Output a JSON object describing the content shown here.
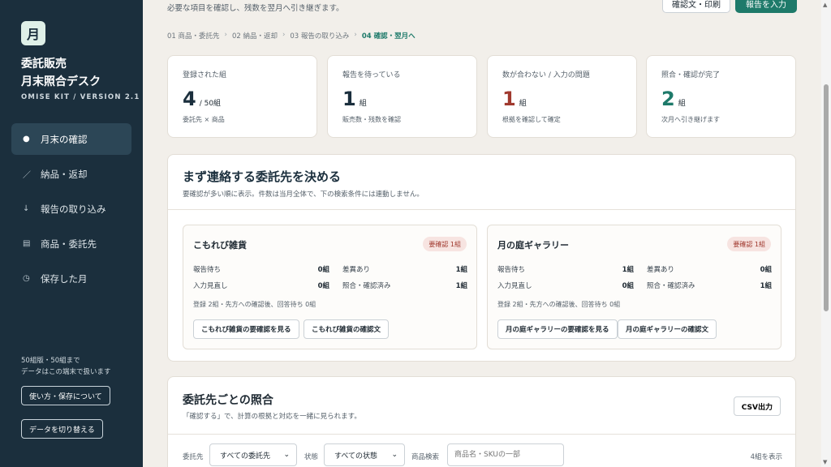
{
  "sidebar": {
    "logo_char": "月",
    "title_line1": "委託販売",
    "title_line2": "月末照合デスク",
    "version": "OMISE KIT / VERSION 2.1",
    "items": [
      {
        "label": "月末の確認",
        "icon": "●",
        "active": true
      },
      {
        "label": "納品・返却",
        "icon": "／",
        "active": false
      },
      {
        "label": "報告の取り込み",
        "icon": "↓",
        "active": false
      },
      {
        "label": "商品・委託先",
        "icon": "▤",
        "active": false
      },
      {
        "label": "保存した月",
        "icon": "◷",
        "active": false
      }
    ],
    "note_line1": "50組版・50組まで",
    "note_line2": "データはこの端末で扱います",
    "help_button": "使い方・保存について",
    "switch_button": "データを切り替える"
  },
  "header": {
    "subtitle": "必要な項目を確認し、残数を翌月へ引き継ぎます。",
    "confirm_print_button": "確認文・印刷",
    "report_button": "報告を入力"
  },
  "steps": [
    {
      "label": "01 商品・委託先",
      "current": false
    },
    {
      "label": "02 納品・返却",
      "current": false
    },
    {
      "label": "03 報告の取り込み",
      "current": false
    },
    {
      "label": "04 確認・翌月へ",
      "current": true
    }
  ],
  "stats": [
    {
      "label": "登録された組",
      "value": "4",
      "unit": "/ 50組",
      "note": "委託先 × 商品",
      "tone": "default"
    },
    {
      "label": "報告を待っている",
      "value": "1",
      "unit": "組",
      "note": "販売数・残数を確認",
      "tone": "default"
    },
    {
      "label": "数が合わない / 入力の問題",
      "value": "1",
      "unit": "組",
      "note": "根拠を確認して確定",
      "tone": "red"
    },
    {
      "label": "照合・確認が完了",
      "value": "2",
      "unit": "組",
      "note": "次月へ引き継げます",
      "tone": "green"
    }
  ],
  "priority": {
    "title": "まず連絡する委託先を決める",
    "subtitle": "要確認が多い順に表示。件数は当月全体で、下の検索条件には連動しません。",
    "consignors": [
      {
        "name": "こもれび雑貨",
        "badge": "要確認 1組",
        "rows": [
          {
            "l1": "報告待ち",
            "v1": "0組",
            "l2": "差異あり",
            "v2": "1組"
          },
          {
            "l1": "入力見直し",
            "v1": "0組",
            "l2": "照合・確認済み",
            "v2": "1組"
          }
        ],
        "note": "登録 2組・先方への確認後、回答待ち 0組",
        "btn1": "こもれび雑貨の要確認を見る",
        "btn2": "こもれび雑貨の確認文"
      },
      {
        "name": "月の庭ギャラリー",
        "badge": "要確認 1組",
        "rows": [
          {
            "l1": "報告待ち",
            "v1": "1組",
            "l2": "差異あり",
            "v2": "0組"
          },
          {
            "l1": "入力見直し",
            "v1": "0組",
            "l2": "照合・確認済み",
            "v2": "1組"
          }
        ],
        "note": "登録 2組・先方への確認後、回答待ち 0組",
        "btn1": "月の庭ギャラリーの要確認を見る",
        "btn2": "月の庭ギャラリーの確認文"
      }
    ]
  },
  "reconcile": {
    "title": "委託先ごとの照合",
    "subtitle": "「確認する」で、計算の根拠と対応を一緒に見られます。",
    "csv_button": "CSV出力",
    "filter_consignor_label": "委託先",
    "filter_consignor_value": "すべての委託先",
    "filter_status_label": "状態",
    "filter_status_value": "すべての状態",
    "search_label": "商品検索",
    "search_placeholder": "商品名・SKUの一部",
    "count": "4組を表示"
  },
  "colors": {
    "sidebar": "#1b2f3d",
    "accent": "#1e7a6a",
    "alert": "#a0392e",
    "background": "#f2efea"
  }
}
